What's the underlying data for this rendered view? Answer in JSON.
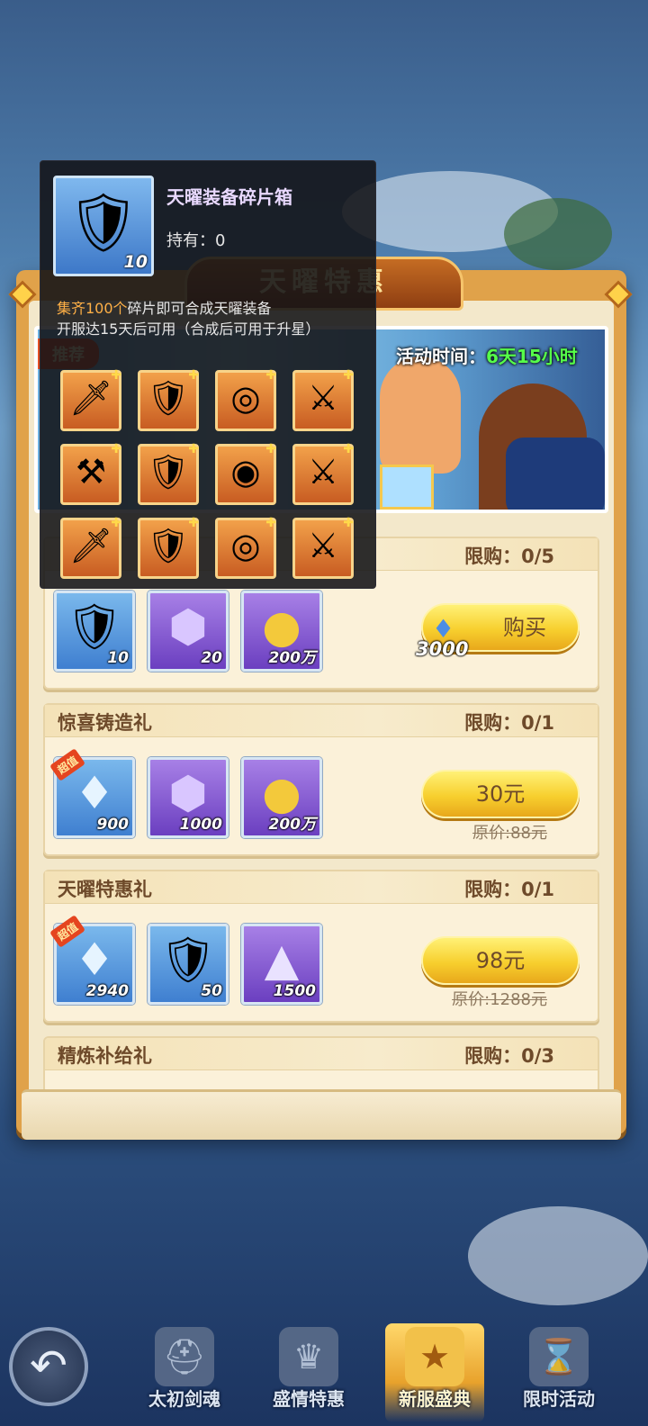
{
  "panel": {
    "title": "天曜特惠"
  },
  "banner": {
    "tag": "推荐",
    "time_label": "活动时间：",
    "time_value": "6天15小时"
  },
  "offers": [
    {
      "title": "",
      "limit": "限购：0/5",
      "items": [
        {
          "icon": "armor-shard-box-icon",
          "count": "10",
          "color": "blue"
        },
        {
          "icon": "purple-gem-icon",
          "count": "20",
          "color": "purple"
        },
        {
          "icon": "gold-coin-icon",
          "count": "200万",
          "color": "purple"
        }
      ],
      "button": {
        "price_icon": "diamond-icon",
        "price": "3000",
        "label": "购买"
      }
    },
    {
      "title": "惊喜铸造礼",
      "limit": "限购：0/1",
      "items": [
        {
          "icon": "diamond-icon",
          "count": "900",
          "color": "blue",
          "badge": "超值"
        },
        {
          "icon": "purple-gem-icon",
          "count": "1000",
          "color": "purple"
        },
        {
          "icon": "gold-coin-icon",
          "count": "200万",
          "color": "purple"
        }
      ],
      "button": {
        "label": "30元"
      },
      "original_price": "原价:88元"
    },
    {
      "title": "天曜特惠礼",
      "limit": "限购：0/1",
      "items": [
        {
          "icon": "diamond-icon",
          "count": "2940",
          "color": "blue",
          "badge": "超值"
        },
        {
          "icon": "armor-shard-box-icon",
          "count": "50",
          "color": "blue"
        },
        {
          "icon": "crystal-shard-icon",
          "count": "1500",
          "color": "purple"
        }
      ],
      "button": {
        "label": "98元"
      },
      "original_price": "原价:1288元"
    },
    {
      "title": "精炼补给礼",
      "limit": "限购：0/3"
    }
  ],
  "tooltip": {
    "title": "天曜装备碎片箱",
    "owned": "持有：0",
    "icon_count": "10",
    "desc_highlight": "集齐100个",
    "desc_rest": "碎片即可合成天曜装备",
    "desc_line2": "开服达15天后可用（合成后可用于升星）",
    "fragments": [
      "sword-fragment-icon",
      "armor-fragment-icon",
      "ring-fragment-icon",
      "boots-fragment-icon",
      "axe-fragment-icon",
      "chestplate-fragment-icon",
      "amulet-fragment-icon",
      "greaves-fragment-icon",
      "blade-fragment-icon",
      "cuirass-fragment-icon",
      "gem-ring-fragment-icon",
      "leggings-fragment-icon"
    ]
  },
  "nav": {
    "back_icon": "back-arrow-icon",
    "items": [
      {
        "label": "太初剑魂",
        "icon": "helmet-icon"
      },
      {
        "label": "盛情特惠",
        "icon": "crown-icon"
      },
      {
        "label": "新服盛典",
        "icon": "star-trophy-icon",
        "active": true
      },
      {
        "label": "限时活动",
        "icon": "hourglass-icon"
      }
    ]
  },
  "colors": {
    "accent": "#e0a24a",
    "highlight": "#ffb046",
    "timer": "#56ff4a"
  }
}
